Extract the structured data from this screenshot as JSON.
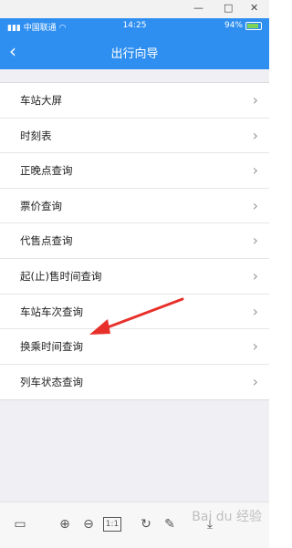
{
  "window": {
    "minimize": "—",
    "maximize": "□",
    "close": "✕"
  },
  "status": {
    "carrier": "中国联通",
    "time": "14:25",
    "battery": "94%"
  },
  "header": {
    "title": "出行向导",
    "back_icon": "chevron-left-icon"
  },
  "list": [
    {
      "label": "车站大屏"
    },
    {
      "label": "时刻表"
    },
    {
      "label": "正晚点查询"
    },
    {
      "label": "票价查询"
    },
    {
      "label": "代售点查询"
    },
    {
      "label": "起(止)售时间查询"
    },
    {
      "label": "车站车次查询"
    },
    {
      "label": "换乘时间查询"
    },
    {
      "label": "列车状态查询"
    }
  ],
  "toolbar": {
    "icons": [
      "layout-icon",
      "zoom-in-icon",
      "zoom-out-icon",
      "actual-size-icon",
      "rotate-icon",
      "edit-icon",
      "download-icon"
    ],
    "actual_size_label": "1:1"
  },
  "watermark": "Bai du 经验",
  "colors": {
    "header": "#2f8ff0",
    "arrow": "#e8302a"
  }
}
